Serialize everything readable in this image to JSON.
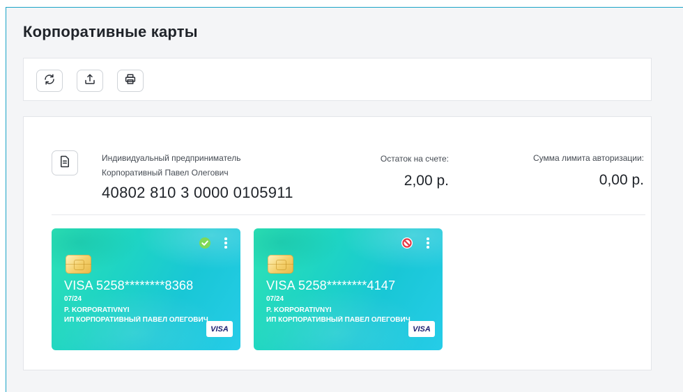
{
  "page": {
    "title": "Корпоративные карты"
  },
  "toolbar": {
    "buttons": [
      {
        "icon": "refresh-icon"
      },
      {
        "icon": "upload-icon"
      },
      {
        "icon": "print-icon"
      }
    ]
  },
  "account": {
    "owner_line1": "Индивидуальный предприниматель",
    "owner_line2": "Корпоративный Павел Олегович",
    "number": "40802 810 3 0000 0105911",
    "balance_label": "Остаток на счете:",
    "balance_value": "2,00 р.",
    "limit_label": "Сумма лимита авторизации:",
    "limit_value": "0,00 р."
  },
  "cards": [
    {
      "number": "VISA 5258********8368",
      "expiry": "07/24",
      "holder": "P. KORPORATIVNYI",
      "company": "ИП КОРПОРАТИВНЫЙ ПАВЕЛ ОЛЕГОВИЧ",
      "brand": "VISA",
      "status": "active",
      "status_icon": "check-circle-icon",
      "status_color": "#7ed957"
    },
    {
      "number": "VISA 5258********4147",
      "expiry": "07/24",
      "holder": "P. KORPORATIVNYI",
      "company": "ИП КОРПОРАТИВНЫЙ ПАВЕЛ ОЛЕГОВИЧ",
      "brand": "VISA",
      "status": "blocked",
      "status_icon": "blocked-icon",
      "status_color": "#e53946"
    }
  ],
  "colors": {
    "accent_border": "#1aa3c6",
    "card_gradient_start": "#2ee3b5",
    "card_gradient_end": "#26cce8",
    "visa_blue": "#1a1f71"
  }
}
